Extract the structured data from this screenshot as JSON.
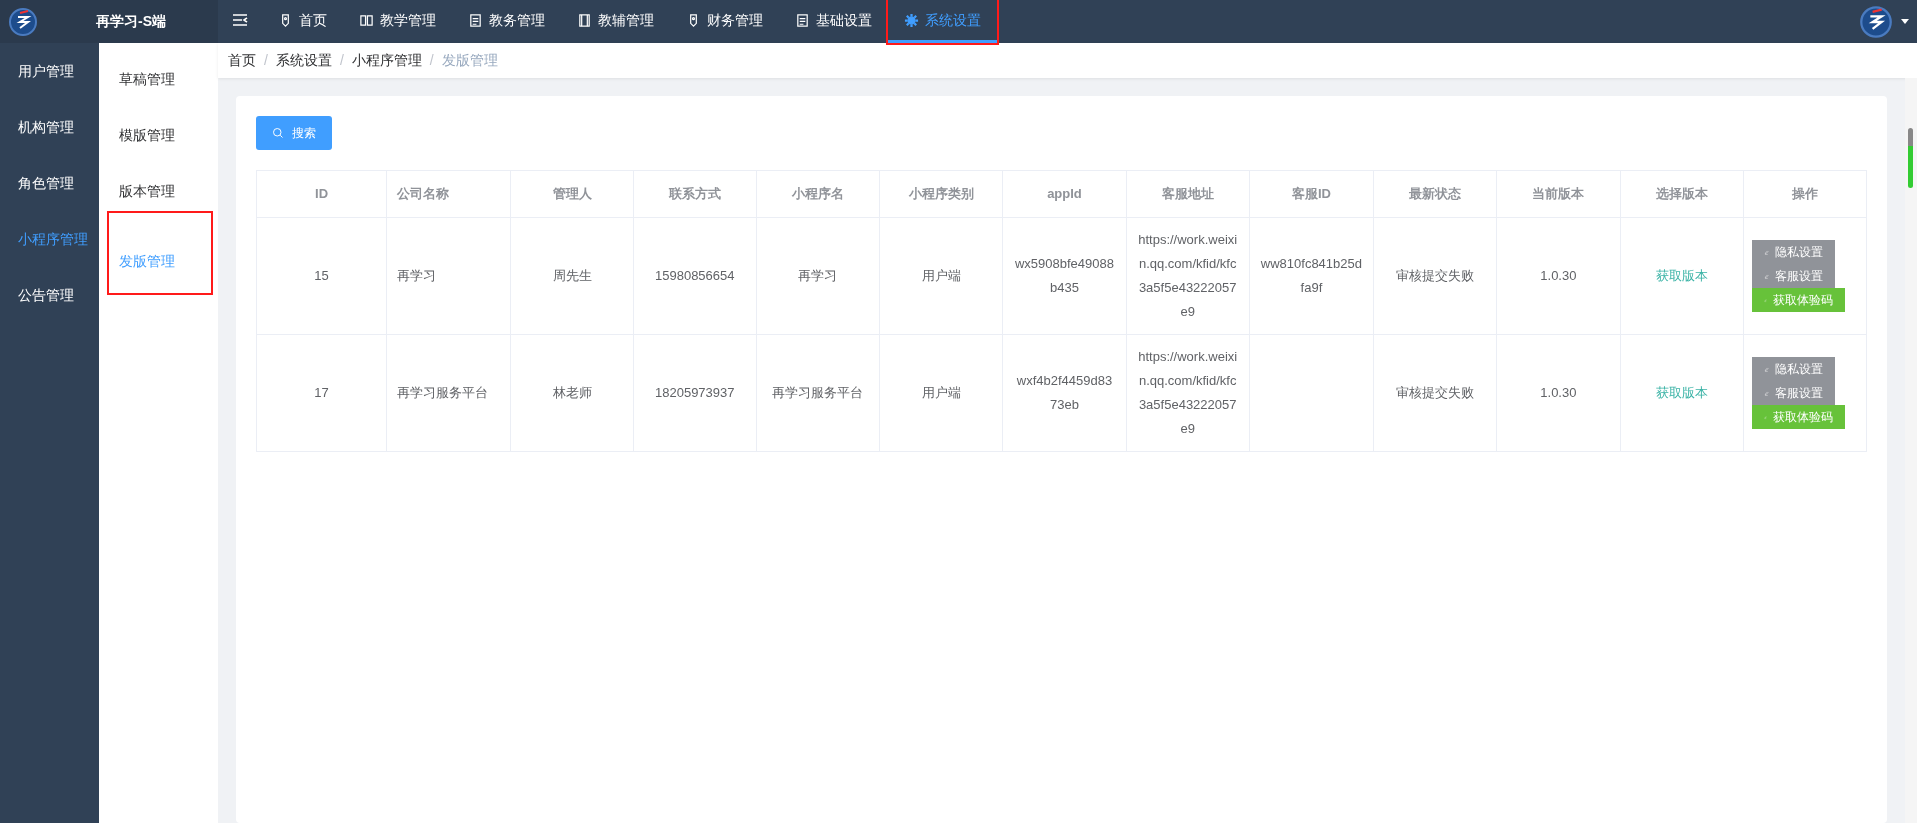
{
  "brand": {
    "title": "再学习-S端"
  },
  "nav": [
    {
      "label": "首页",
      "selected": false,
      "highlighted": false
    },
    {
      "label": "教学管理",
      "selected": false,
      "highlighted": false
    },
    {
      "label": "教务管理",
      "selected": false,
      "highlighted": false
    },
    {
      "label": "教辅管理",
      "selected": false,
      "highlighted": false
    },
    {
      "label": "财务管理",
      "selected": false,
      "highlighted": false
    },
    {
      "label": "基础设置",
      "selected": false,
      "highlighted": false
    },
    {
      "label": "系统设置",
      "selected": true,
      "highlighted": true
    }
  ],
  "sidebar": {
    "items": [
      {
        "label": "用户管理",
        "selected": false
      },
      {
        "label": "机构管理",
        "selected": false
      },
      {
        "label": "角色管理",
        "selected": false
      },
      {
        "label": "小程序管理",
        "selected": true
      },
      {
        "label": "公告管理",
        "selected": false
      }
    ]
  },
  "submenu": {
    "items": [
      {
        "label": "草稿管理",
        "selected": false,
        "highlighted": false
      },
      {
        "label": "模版管理",
        "selected": false,
        "highlighted": false
      },
      {
        "label": "版本管理",
        "selected": false,
        "highlighted": false
      },
      {
        "label": "发版管理",
        "selected": true,
        "highlighted": true
      }
    ]
  },
  "breadcrumb": [
    {
      "label": "首页"
    },
    {
      "separator": "/",
      "label": "系统设置"
    },
    {
      "separator": "/",
      "label": "小程序管理"
    },
    {
      "separator": "/",
      "label": "发版管理"
    }
  ],
  "search_button": "搜索",
  "table": {
    "columns": [
      "ID",
      "公司名称",
      "管理人",
      "联系方式",
      "小程序名",
      "小程序类别",
      "appId",
      "客服地址",
      "客服ID",
      "最新状态",
      "当前版本",
      "选择版本",
      "操作"
    ],
    "rows": [
      {
        "cells": [
          "15",
          "再学习",
          "周先生",
          "15980856654",
          "再学习",
          "用户端",
          "wx5908bfe49088b435",
          "https://work.weixin.qq.com/kfid/kfc3a5f5e43222057e9",
          "ww810fc841b25dfa9f",
          "审核提交失败",
          "1.0.30"
        ],
        "link": "获取版本",
        "actions": [
          {
            "label": "隐私设置",
            "kind": "grey"
          },
          {
            "label": "客服设置",
            "kind": "grey"
          },
          {
            "label": "获取体验码",
            "kind": "green"
          }
        ]
      },
      {
        "cells": [
          "17",
          "再学习服务平台",
          "林老师",
          "18205973937",
          "再学习服务平台",
          "用户端",
          "wxf4b2f4459d8373eb",
          "https://work.weixin.qq.com/kfid/kfc3a5f5e43222057e9",
          "",
          "审核提交失败",
          "1.0.30"
        ],
        "link": "获取版本",
        "actions": [
          {
            "label": "隐私设置",
            "kind": "grey"
          },
          {
            "label": "客服设置",
            "kind": "grey"
          },
          {
            "label": "获取体验码",
            "kind": "green"
          }
        ]
      }
    ]
  }
}
